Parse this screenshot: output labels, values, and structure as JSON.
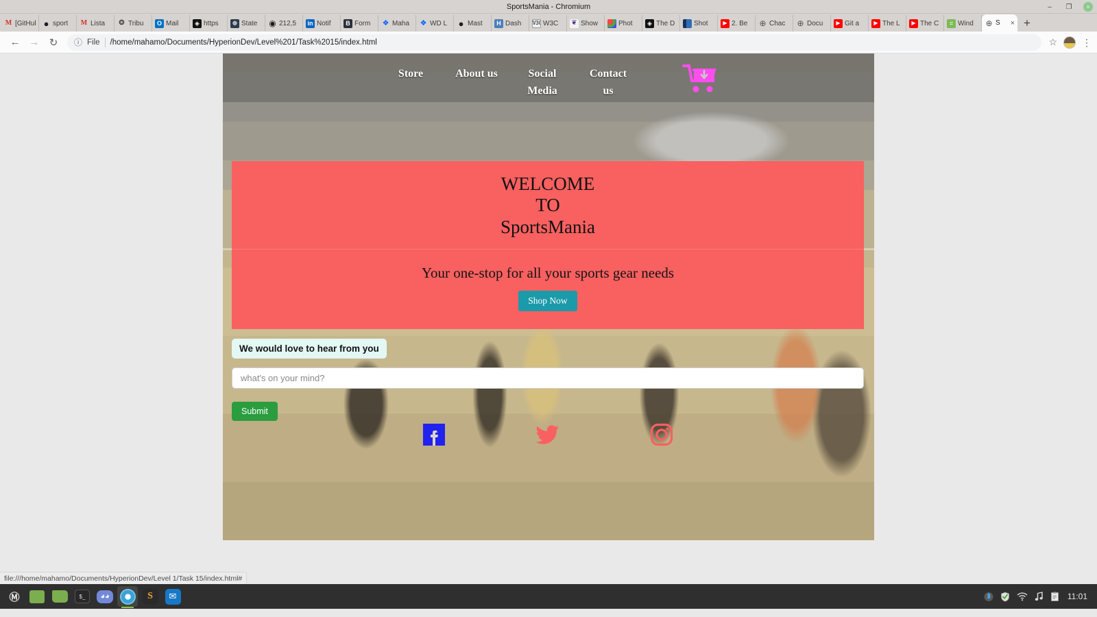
{
  "window": {
    "title": "SportsMania - Chromium",
    "controls": {
      "minimize": "–",
      "maximize": "❐",
      "close": "×"
    }
  },
  "tabs": [
    {
      "title": "[GitHub]",
      "icon": "gmail-icon"
    },
    {
      "title": "sport",
      "icon": "github-icon"
    },
    {
      "title": "Lista",
      "icon": "gmail-icon"
    },
    {
      "title": "Tribu",
      "icon": "tribe-icon"
    },
    {
      "title": "Mail",
      "icon": "outlook-icon"
    },
    {
      "title": "https",
      "icon": "dark-icon"
    },
    {
      "title": "State",
      "icon": "stack-icon"
    },
    {
      "title": "212,5",
      "icon": "circle-icon"
    },
    {
      "title": "Notif",
      "icon": "linkedin-icon"
    },
    {
      "title": "Form",
      "icon": "b-icon"
    },
    {
      "title": "Maha",
      "icon": "dropbox-icon"
    },
    {
      "title": "WD L",
      "icon": "dropbox-icon"
    },
    {
      "title": "Mast",
      "icon": "github-icon"
    },
    {
      "title": "Dash",
      "icon": "dashboard-icon"
    },
    {
      "title": "W3C",
      "icon": "w3c-icon"
    },
    {
      "title": "Show",
      "icon": "show-icon"
    },
    {
      "title": "Phot",
      "icon": "photo-icon"
    },
    {
      "title": "The D",
      "icon": "dark-icon"
    },
    {
      "title": "Shot",
      "icon": "shot-icon"
    },
    {
      "title": "2. Be",
      "icon": "youtube-icon"
    },
    {
      "title": "Chac",
      "icon": "globe-icon"
    },
    {
      "title": "Docu",
      "icon": "globe-icon"
    },
    {
      "title": "Git a",
      "icon": "youtube-icon"
    },
    {
      "title": "The L",
      "icon": "youtube-icon"
    },
    {
      "title": "The C",
      "icon": "youtube-icon"
    },
    {
      "title": "Wind",
      "icon": "windows-icon"
    },
    {
      "title": "S",
      "icon": "globe-icon",
      "active": true,
      "close": "×"
    }
  ],
  "newtab_label": "+",
  "toolbar": {
    "back": "←",
    "forward": "→",
    "reload": "↻",
    "info_icon": "ⓘ",
    "scheme_label": "File",
    "url": "/home/mahamo/Documents/HyperionDev/Level%201/Task%2015/index.html",
    "bookmark_star": "☆",
    "menu_kebab": "⋮"
  },
  "site": {
    "nav": [
      {
        "label": "Store"
      },
      {
        "label": "About us"
      },
      {
        "label": "Social Media"
      },
      {
        "label": "Contact us"
      }
    ],
    "cart_icon": "shopping-cart-download-icon",
    "hero": {
      "line1": "WELCOME",
      "line2": "TO",
      "line3": "SportsMania",
      "tagline": "Your one-stop for all your sports gear needs",
      "cta_label": "Shop Now",
      "banner_color": "#f96060",
      "cta_color": "#1b9aaa"
    },
    "contact": {
      "label": "We would love to hear from you",
      "input_value": "",
      "input_placeholder": "what's on your mind?",
      "submit_label": "Submit",
      "submit_color": "#2a9d3f"
    },
    "social": [
      {
        "name": "facebook-icon",
        "color": "#2222ee"
      },
      {
        "name": "twitter-icon",
        "color": "#f96060"
      },
      {
        "name": "instagram-icon",
        "color": "#f96060"
      }
    ]
  },
  "status_bar": {
    "text": "file:///home/mahamo/Documents/HyperionDev/Level 1/Task 15/index.html#"
  },
  "taskbar": {
    "apps": [
      {
        "name": "linux-mint-menu",
        "glyph": "Ⓜ"
      },
      {
        "name": "show-desktop",
        "glyph": ""
      },
      {
        "name": "file-manager",
        "glyph": ""
      },
      {
        "name": "terminal",
        "glyph": "$_"
      },
      {
        "name": "discord",
        "glyph": "◕◕"
      },
      {
        "name": "chromium",
        "glyph": "",
        "running": true
      },
      {
        "name": "sublime-text",
        "glyph": "S"
      },
      {
        "name": "vscode",
        "glyph": "✉"
      }
    ],
    "tray": [
      {
        "name": "bluetooth-icon",
        "glyph": "ᛦ"
      },
      {
        "name": "shield-icon",
        "glyph": "⛨"
      },
      {
        "name": "wifi-icon",
        "glyph": "◠"
      },
      {
        "name": "volume-icon",
        "glyph": "♫"
      },
      {
        "name": "clipboard-icon",
        "glyph": "Ὕ2"
      }
    ],
    "clock": "11:01"
  }
}
